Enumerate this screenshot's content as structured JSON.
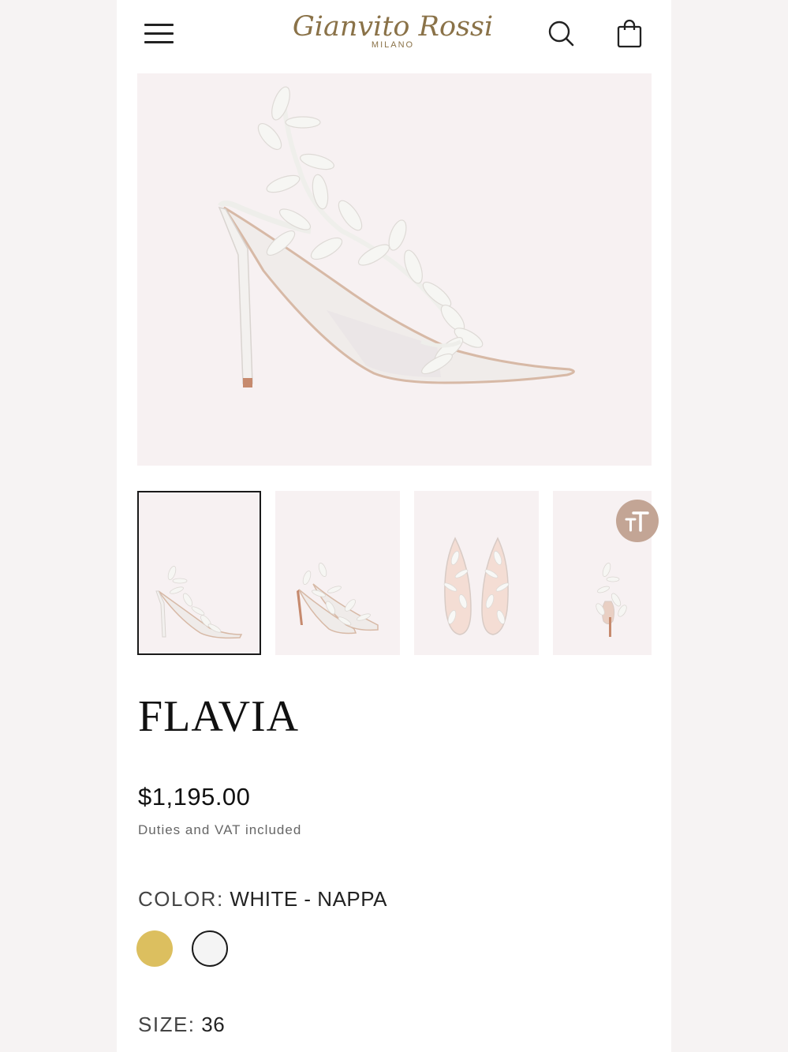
{
  "header": {
    "brand_script": "Gianvito Rossi",
    "brand_sub": "MILANO",
    "icons": [
      "menu-icon",
      "search-icon",
      "shopping-bag-icon"
    ]
  },
  "gallery": {
    "thumbnail_count": 4,
    "selected_index": 0,
    "fab_icon": "text-size-icon"
  },
  "product": {
    "name": "FLAVIA",
    "price": "$1,195.00",
    "duties_note": "Duties and VAT included",
    "color_label": "COLOR:",
    "color_value": "WHITE - NAPPA",
    "swatches": [
      {
        "name": "gold",
        "color": "#dcbf5f"
      },
      {
        "name": "white",
        "color": "#f4f4f4"
      }
    ],
    "size_label": "SIZE:",
    "size_value": "36"
  },
  "colors": {
    "brand": "#8a7248",
    "image_bg": "#f7f1f2",
    "fab": "#c3a595"
  }
}
